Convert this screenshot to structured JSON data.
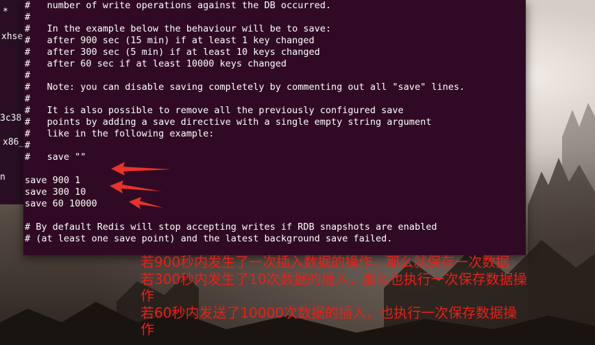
{
  "background_terminal": {
    "fragments": [
      "*",
      "xhse",
      "3c38",
      "x86_",
      "n"
    ]
  },
  "terminal": {
    "lines": [
      "#   number of write operations against the DB occurred.",
      "#",
      "#   In the example below the behaviour will be to save:",
      "#   after 900 sec (15 min) if at least 1 key changed",
      "#   after 300 sec (5 min) if at least 10 keys changed",
      "#   after 60 sec if at least 10000 keys changed",
      "#",
      "#   Note: you can disable saving completely by commenting out all \"save\" lines.",
      "#",
      "#   It is also possible to remove all the previously configured save",
      "#   points by adding a save directive with a single empty string argument",
      "#   like in the following example:",
      "#",
      "#   save \"\"",
      "",
      "save 900 1",
      "save 300 10",
      "save 60 10000",
      "",
      "# By default Redis will stop accepting writes if RDB snapshots are enabled",
      "# (at least one save point) and the latest background save failed."
    ]
  },
  "annotations": [
    "若900秒内发生了一次插入数据的操作，那么就保存一次数据",
    "若300秒内发生了10次数据的插入，那么也执行一次保存数据操",
    "作",
    "若60秒内发送了10000次数据的插入，也执行一次保存数据操",
    "作"
  ],
  "colors": {
    "terminal_bg": "#300a24",
    "terminal_text": "#ffffff",
    "annotation_red": "#e8201a",
    "arrow_red": "#e8322a"
  }
}
